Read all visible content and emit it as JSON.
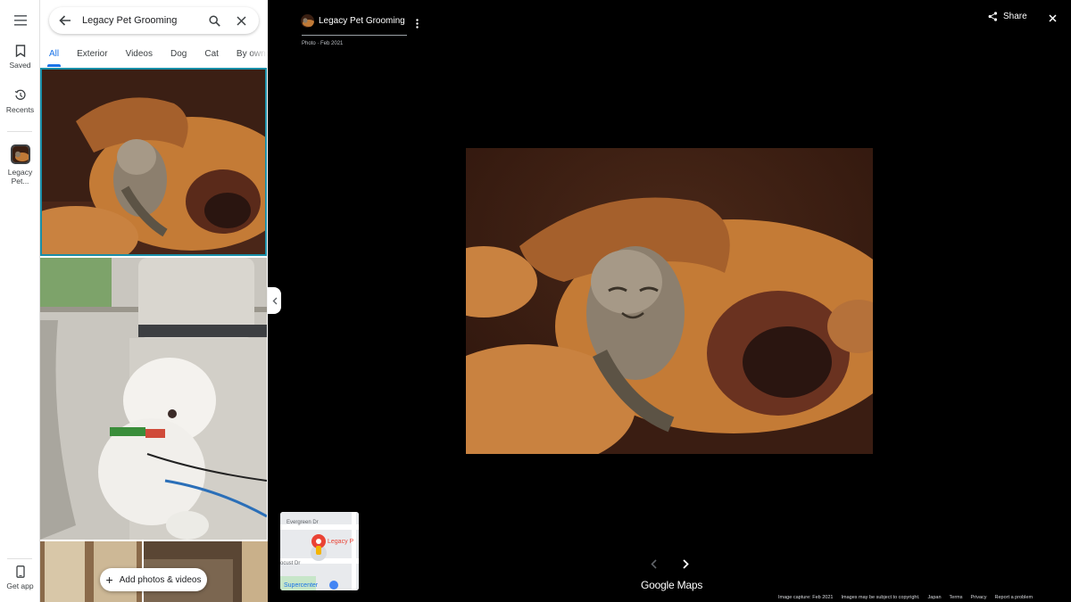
{
  "rail": {
    "saved_label": "Saved",
    "recents_label": "Recents",
    "place_label_line1": "Legacy",
    "place_label_line2": "Pet...",
    "get_app_label": "Get app"
  },
  "search": {
    "value": "Legacy Pet Grooming"
  },
  "tabs": [
    {
      "label": "All"
    },
    {
      "label": "Exterior"
    },
    {
      "label": "Videos"
    },
    {
      "label": "Dog"
    },
    {
      "label": "Cat"
    },
    {
      "label": "By owner"
    }
  ],
  "add_photos_label": "Add photos & videos",
  "viewer": {
    "place_name": "Legacy Pet Grooming",
    "photo_meta": "Photo · Feb 2021",
    "share_label": "Share",
    "logo_text": "Google Maps"
  },
  "minimap": {
    "street1": "Evergreen Dr",
    "street2": "ocust Dr",
    "place_label": "Legacy P",
    "store_label": "Supercenter"
  },
  "footer": {
    "capture": "Image capture: Feb 2021",
    "copyright": "Images may be subject to copyright.",
    "region": "Japan",
    "terms": "Terms",
    "privacy": "Privacy",
    "report": "Report a problem"
  },
  "colors": {
    "accent": "#1a73e8",
    "selected_outline": "#1a8fa8",
    "pin_red": "#ea4335"
  }
}
